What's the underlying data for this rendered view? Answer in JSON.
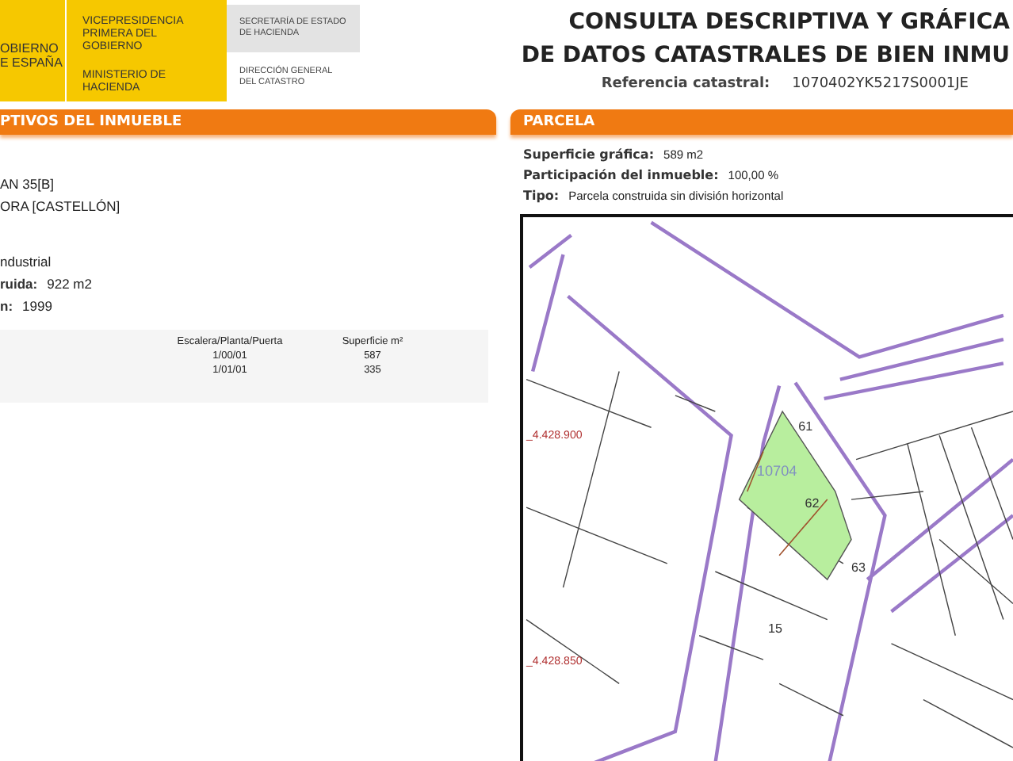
{
  "header": {
    "logo_lines": [
      "OBIERNO",
      "E ESPAÑA"
    ],
    "ministry": [
      {
        "text": "VICEPRESIDENCIA PRIMERA DEL GOBIERNO"
      },
      {
        "text": "MINISTERIO DE HACIENDA"
      }
    ],
    "secretary": "SECRETARÍA DE ESTADO DE HACIENDA",
    "direction": "DIRECCIÓN GENERAL DEL CATASTRO",
    "title_lines": [
      "CONSULTA DESCRIPTIVA Y GRÁFICA",
      "DE DATOS CATASTRALES DE BIEN INMU"
    ],
    "reference": {
      "label": "Referencia catastral:",
      "value": "1070402YK5217S0001JE"
    }
  },
  "left_section": {
    "title": "PTIVOS DEL INMUEBLE",
    "groups": [
      {
        "fields": [
          {
            "value": "AN 35[B]"
          },
          {
            "value": "ORA [CASTELLÓN]"
          }
        ]
      },
      {
        "fields": [
          {
            "value": "ndustrial"
          },
          {
            "label": "ruida:",
            "value": "922 m2"
          },
          {
            "label": "n:",
            "value": "1999"
          }
        ]
      }
    ],
    "table": {
      "columns": [
        "Escalera/Planta/Puerta",
        "Superficie m²"
      ],
      "rows": [
        [
          "1/00/01",
          "587"
        ],
        [
          "1/01/01",
          "335"
        ]
      ]
    }
  },
  "parcel": {
    "title": "PARCELA",
    "fields": [
      {
        "label": "Superficie gráfica:",
        "value": "589 m2"
      },
      {
        "label": "Participación del inmueble:",
        "value": "100,00 %"
      },
      {
        "label": "Tipo:",
        "value": "Parcela construida sin división horizontal"
      }
    ],
    "map": {
      "labels": [
        {
          "text": "61",
          "kind": "number"
        },
        {
          "text": "10704",
          "kind": "parcel"
        },
        {
          "text": "62",
          "kind": "number"
        },
        {
          "text": "63",
          "kind": "number"
        },
        {
          "text": "15",
          "kind": "number"
        },
        {
          "text": "_4.428.900",
          "kind": "coord"
        },
        {
          "text": "_4.428.850",
          "kind": "coord"
        }
      ]
    }
  }
}
